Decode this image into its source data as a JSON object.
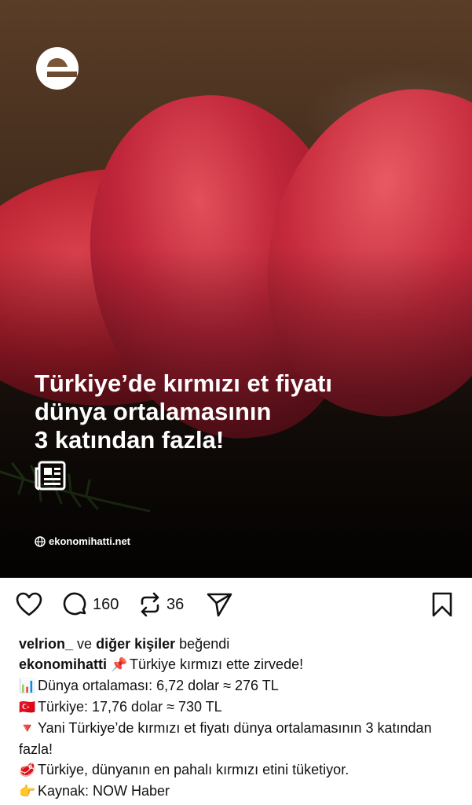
{
  "post": {
    "headline": [
      "Türkiye’de kırmızı et fiyatı",
      "dünya ortalamasının",
      "3 katından fazla!"
    ],
    "site": "ekonomihatti.net",
    "logo_letter": "e"
  },
  "actions": {
    "comment_count": "160",
    "repost_count": "36"
  },
  "likes": {
    "user": "velrion_",
    "connector": "ve",
    "others": "diğer kişiler",
    "suffix": "beğendi"
  },
  "caption": {
    "author": "ekonomihatti",
    "lines": [
      {
        "emoji": "📌",
        "text": "Türkiye kırmızı ette zirvede!"
      },
      {
        "emoji": "📊",
        "text": "Dünya ortalaması: 6,72 dolar ≈ 276 TL"
      },
      {
        "emoji": "🇹🇷",
        "text": "Türkiye: 17,76 dolar ≈ 730 TL"
      },
      {
        "emoji": "🔻",
        "text": "Yani Türkiye’de kırmızı et fiyatı dünya ortalamasının 3 katından fazla!"
      },
      {
        "emoji": "🥩",
        "text": "Türkiye, dünyanın en pahalı kırmızı etini tüketiyor."
      },
      {
        "emoji": "👉",
        "text": "Kaynak: NOW Haber"
      }
    ]
  },
  "icons": {
    "like": "heart-icon",
    "comment": "comment-icon",
    "repost": "repost-icon",
    "share": "send-icon",
    "save": "bookmark-icon"
  }
}
